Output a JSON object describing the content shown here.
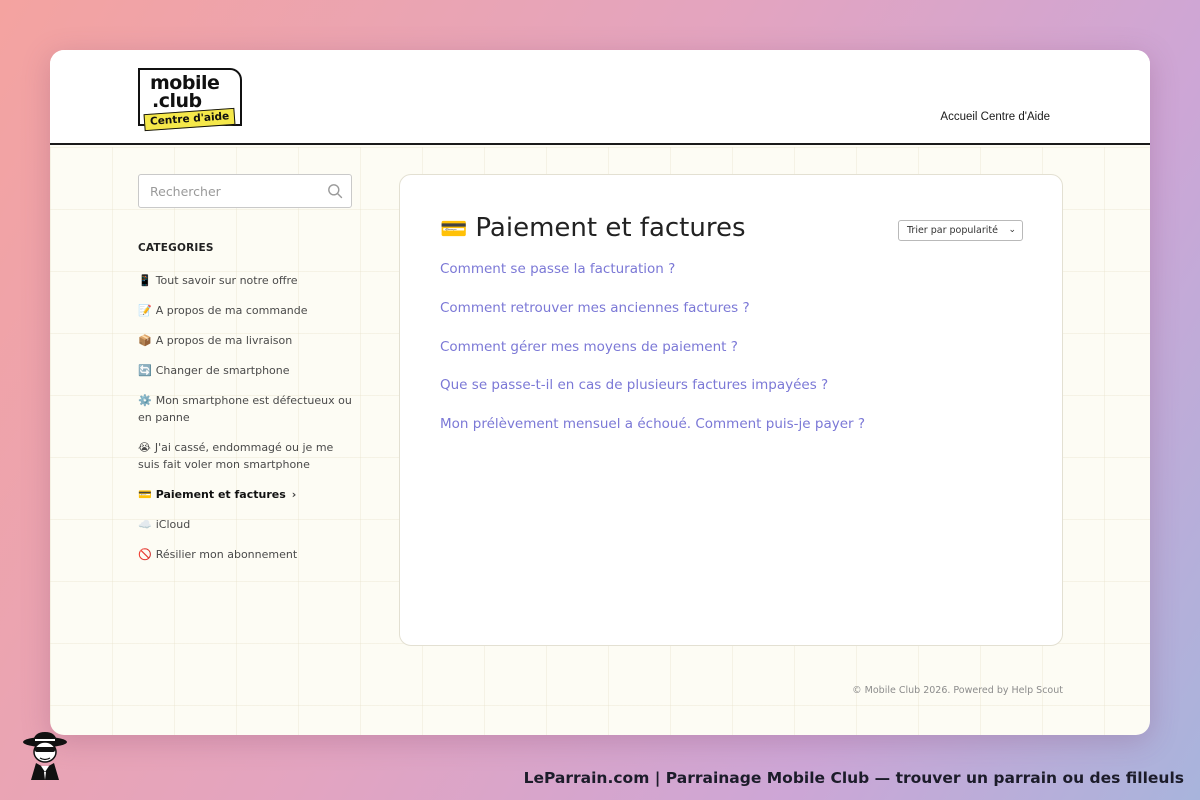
{
  "header": {
    "logo_line1": "mobile",
    "logo_line2": ".club",
    "logo_tag": "Centre d'aide",
    "nav_link": "Accueil Centre d'Aide"
  },
  "sidebar": {
    "search_placeholder": "Rechercher",
    "categories_title": "CATEGORIES",
    "items": [
      {
        "emoji": "📱",
        "label": "Tout savoir sur notre offre",
        "active": false
      },
      {
        "emoji": "📝",
        "label": "A propos de ma commande",
        "active": false
      },
      {
        "emoji": "📦",
        "label": "A propos de ma livraison",
        "active": false
      },
      {
        "emoji": "🔄",
        "label": "Changer de smartphone",
        "active": false
      },
      {
        "emoji": "⚙️",
        "label": "Mon smartphone est défectueux ou en panne",
        "active": false
      },
      {
        "emoji": "😭",
        "label": "J'ai cassé, endommagé ou je me suis fait voler mon smartphone",
        "active": false
      },
      {
        "emoji": "💳",
        "label": "Paiement et factures",
        "active": true
      },
      {
        "emoji": "☁️",
        "label": "iCloud",
        "active": false
      },
      {
        "emoji": "🚫",
        "label": "Résilier mon abonnement",
        "active": false
      }
    ]
  },
  "main": {
    "title_emoji": "💳",
    "title": "Paiement et factures",
    "sort_label": "Trier par popularité",
    "articles": [
      "Comment se passe la facturation ?",
      "Comment retrouver mes anciennes factures ?",
      "Comment gérer mes moyens de paiement ?",
      "Que se passe-t-il en cas de plusieurs factures impayées ?",
      "Mon prélèvement mensuel a échoué. Comment puis-je payer ?"
    ]
  },
  "footer": {
    "text": "© Mobile Club 2026. Powered by Help Scout"
  },
  "banner": {
    "text": "LeParrain.com | Parrainage Mobile Club — trouver un parrain ou des filleuls"
  },
  "colors": {
    "link": "#7b78d6",
    "logo_tag_bg": "#f5e84a",
    "page_bg": "#fdfcf4"
  },
  "icons": {
    "search": "search-icon",
    "sort": "chevron-down-icon",
    "active_item": "chevron-right-icon"
  }
}
